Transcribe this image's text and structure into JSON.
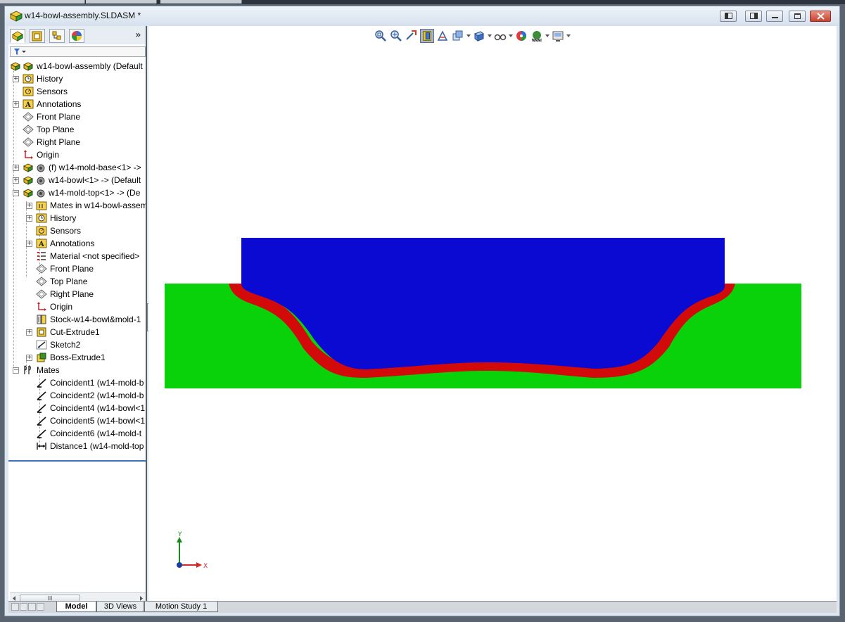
{
  "window": {
    "title": "w14-bowl-assembly.SLDASM *"
  },
  "feature_tree": {
    "root": "w14-bowl-assembly  (Default",
    "rows": [
      {
        "label": "History",
        "icon": "history-icon"
      },
      {
        "label": "Sensors",
        "icon": "sensors-icon"
      },
      {
        "label": "Annotations",
        "icon": "annotations-icon"
      },
      {
        "label": "Front Plane",
        "icon": "plane-icon"
      },
      {
        "label": "Top Plane",
        "icon": "plane-icon"
      },
      {
        "label": "Right Plane",
        "icon": "plane-icon"
      },
      {
        "label": "Origin",
        "icon": "origin-icon"
      },
      {
        "label": "(f) w14-mold-base<1> ->",
        "icon": "part-icon"
      },
      {
        "label": "w14-bowl<1> -> (Default",
        "icon": "part-icon"
      },
      {
        "label": "w14-mold-top<1> -> (De",
        "icon": "part-icon"
      },
      {
        "label": "Mates in w14-bowl-assem",
        "icon": "mates-folder-icon"
      },
      {
        "label": "History",
        "icon": "history-icon"
      },
      {
        "label": "Sensors",
        "icon": "sensors-icon"
      },
      {
        "label": "Annotations",
        "icon": "annotations-icon"
      },
      {
        "label": "Material <not specified>",
        "icon": "material-icon"
      },
      {
        "label": "Front Plane",
        "icon": "plane-icon"
      },
      {
        "label": "Top Plane",
        "icon": "plane-icon"
      },
      {
        "label": "Right Plane",
        "icon": "plane-icon"
      },
      {
        "label": "Origin",
        "icon": "origin-icon"
      },
      {
        "label": "Stock-w14-bowl&mold-1",
        "icon": "stock-icon"
      },
      {
        "label": "Cut-Extrude1",
        "icon": "cut-extrude-icon"
      },
      {
        "label": "Sketch2",
        "icon": "sketch-icon"
      },
      {
        "label": "Boss-Extrude1",
        "icon": "boss-extrude-icon"
      },
      {
        "label": "Mates",
        "icon": "mates-icon"
      },
      {
        "label": "Coincident1 (w14-mold-b",
        "icon": "coincident-icon"
      },
      {
        "label": "Coincident2 (w14-mold-b",
        "icon": "coincident-icon"
      },
      {
        "label": "Coincident4 (w14-bowl<1",
        "icon": "coincident-icon"
      },
      {
        "label": "Coincident5 (w14-bowl<1",
        "icon": "coincident-icon"
      },
      {
        "label": "Coincident6 (w14-mold-t",
        "icon": "coincident-icon"
      },
      {
        "label": "Distance1 (w14-mold-top",
        "icon": "distance-icon"
      }
    ]
  },
  "bottom_tabs": [
    "Model",
    "3D Views",
    "Motion Study 1"
  ],
  "triad": {
    "y_label": "Y",
    "x_label": "X"
  },
  "scrollbar_thumb": "III",
  "colors": {
    "mold_top": "#0a0ad2",
    "mold_base": "#0ad20a",
    "bowl": "#d20a0a"
  }
}
